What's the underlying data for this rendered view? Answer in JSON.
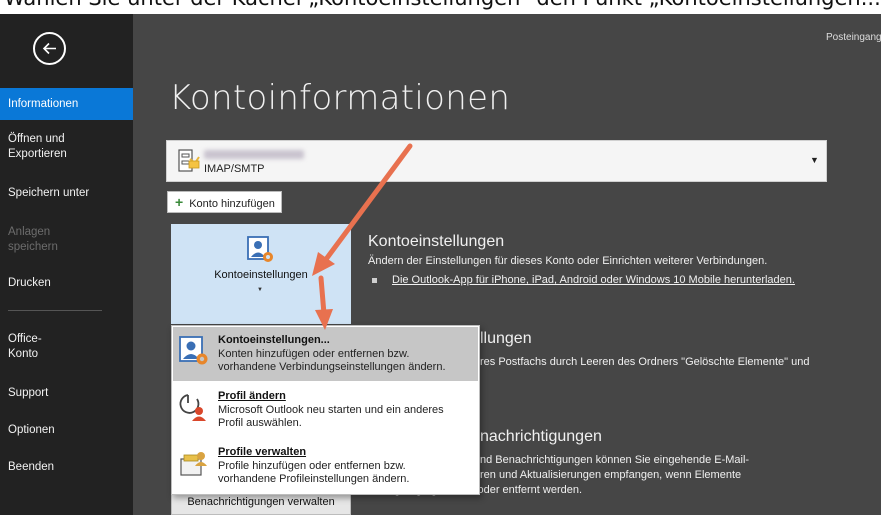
{
  "caption": "Wählen Sie unter der Kachel „Kontoeinstellungen“ den Punkt „Kontoeinstellungen...“",
  "window": {
    "topright_label": "Posteingang"
  },
  "sidebar": {
    "items": [
      {
        "label": "Informationen",
        "state": "active"
      },
      {
        "label": "Öffnen und Exportieren",
        "state": "normal"
      },
      {
        "label": "Speichern unter",
        "state": "normal"
      },
      {
        "label": "Anlagen speichern",
        "state": "disabled"
      },
      {
        "label": "Drucken",
        "state": "normal"
      },
      {
        "label": "Office-Konto",
        "state": "normal"
      },
      {
        "label": "Support",
        "state": "normal"
      },
      {
        "label": "Optionen",
        "state": "normal"
      },
      {
        "label": "Beenden",
        "state": "normal"
      }
    ]
  },
  "main": {
    "title": "Kontoinformationen",
    "account": {
      "type": "IMAP/SMTP"
    },
    "add_account_label": "Konto hinzufügen",
    "kontoeinstellungen_tile": {
      "label": "Kontoeinstellungen"
    },
    "sections": {
      "account_settings": {
        "heading": "Kontoeinstellungen",
        "desc": "Ändern der Einstellungen für dieses Konto oder Einrichten weiterer Verbindungen.",
        "link": "Die Outlook-App für iPhone, iPad, Android oder Windows 10 Mobile herunterladen."
      },
      "mailbox": {
        "heading_fragment": "llungen",
        "desc_fragment": "res Postfachs durch Leeren des Ordners \"Gelöschte Elemente\" und"
      },
      "notifications": {
        "heading_fragment": "nachrichtigungen",
        "line1": "nd Benachrichtigungen können Sie eingehende E-Mail-",
        "line2": "ren und Aktualisierungen empfangen, wenn Elemente",
        "line3": "hinzugefügt, geändert oder entfernt werden.",
        "button": "Benachrichtigungen verwalten"
      }
    }
  },
  "dropdown_menu": {
    "items": [
      {
        "title": "Kontoeinstellungen...",
        "desc_line1": "Konten hinzufügen oder entfernen bzw.",
        "desc_line2": "vorhandene Verbindungseinstellungen ändern.",
        "highlighted": true
      },
      {
        "title": "Profil ändern",
        "desc_line1": "Microsoft Outlook neu starten und ein anderes",
        "desc_line2": "Profil auswählen.",
        "highlighted": false
      },
      {
        "title": "Profile verwalten",
        "desc_line1": "Profile hinzufügen oder entfernen bzw.",
        "desc_line2": "vorhandene Profileinstellungen ändern.",
        "highlighted": false
      }
    ]
  },
  "colors": {
    "accent": "#0a78d7",
    "annotation_arrow": "#e8714f",
    "tile_bg": "#cfe3f5"
  }
}
